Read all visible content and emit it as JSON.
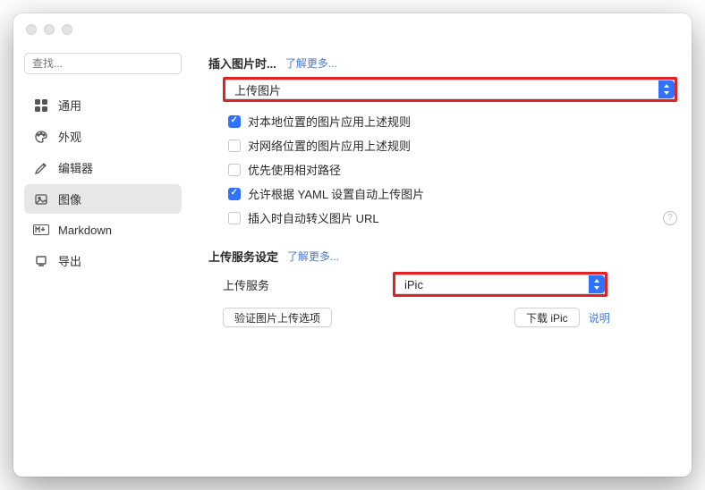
{
  "search": {
    "placeholder": "查找..."
  },
  "sidebar": {
    "items": [
      {
        "label": "通用"
      },
      {
        "label": "外观"
      },
      {
        "label": "编辑器"
      },
      {
        "label": "图像"
      },
      {
        "label": "Markdown"
      },
      {
        "label": "导出"
      }
    ]
  },
  "section1": {
    "title": "插入图片时...",
    "learn_more": "了解更多...",
    "action_select": "上传图片",
    "checks": [
      {
        "label": "对本地位置的图片应用上述规则",
        "checked": true
      },
      {
        "label": "对网络位置的图片应用上述规则",
        "checked": false
      },
      {
        "label": "优先使用相对路径",
        "checked": false
      },
      {
        "label": "允许根据 YAML 设置自动上传图片",
        "checked": true
      },
      {
        "label": "插入时自动转义图片 URL",
        "checked": false,
        "help": true
      }
    ]
  },
  "section2": {
    "title": "上传服务设定",
    "learn_more": "了解更多...",
    "service_label": "上传服务",
    "service_value": "iPic",
    "verify_btn": "验证图片上传选项",
    "download_btn": "下载 iPic",
    "desc_link": "说明"
  }
}
